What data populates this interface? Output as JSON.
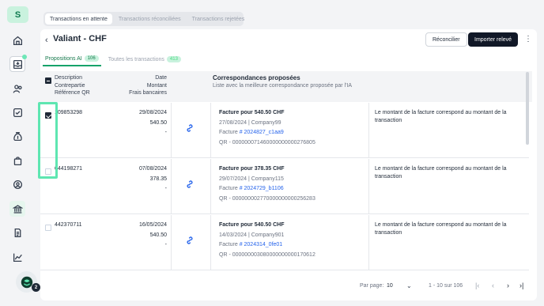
{
  "app": {
    "logo": "S"
  },
  "top_tabs": [
    "Transactions en attente",
    "Transactions réconciliées",
    "Transactions rejetées"
  ],
  "header": {
    "title": "Valiant - CHF",
    "reconcile_label": "Réconcilier",
    "import_label": "Importer relevé"
  },
  "sub_tabs": [
    {
      "label": "Propositions AI",
      "count": "106"
    },
    {
      "label": "Toutes les transactions",
      "count": "413"
    }
  ],
  "table_head": {
    "col1": [
      "Description",
      "Contrepartie",
      "Référence QR"
    ],
    "col2": [
      "Date",
      "Montant",
      "Frais bancaires"
    ],
    "col3_title": "Correspondances proposées",
    "col3_sub": "Liste avec la meilleure correspondance proposée par l'IA"
  },
  "rows": [
    {
      "checked": true,
      "ref": "109853298",
      "date": "29/08/2024",
      "amount": "540.50",
      "fee": "-",
      "match_title": "Facture pour 540.50 CHF",
      "match_meta": "27/08/2024 | Company99",
      "invoice_prefix": "Facture ",
      "invoice_ref": "# 2024827_c1aa9",
      "qr": "QR - 000000071460000000000276805",
      "reason": "Le montant de la facture correspond au montant de la transaction"
    },
    {
      "checked": false,
      "ref": "644198271",
      "date": "07/08/2024",
      "amount": "378.35",
      "fee": "-",
      "match_title": "Facture pour 378.35 CHF",
      "match_meta": "29/07/2024 | Company115",
      "invoice_prefix": "Facture ",
      "invoice_ref": "# 2024729_b1106",
      "qr": "QR - 000000002770000000000256283",
      "reason": "Le montant de la facture correspond au montant de la transaction"
    },
    {
      "checked": false,
      "ref": "442370711",
      "date": "16/05/2024",
      "amount": "540.50",
      "fee": "-",
      "match_title": "Facture pour 540.50 CHF",
      "match_meta": "14/03/2024 | Company901",
      "invoice_prefix": "Facture ",
      "invoice_ref": "# 2024314_0fe01",
      "qr": "QR - 000000003080000000000170612",
      "reason": "Le montant de la facture correspond au montant de la transaction"
    }
  ],
  "footer": {
    "per_page_label": "Par page:",
    "per_page_value": "10",
    "range": "1 - 10 sur 106"
  },
  "avatar_badge": "2",
  "colors": {
    "accent": "#16a36a",
    "link": "#2563eb",
    "dark_button": "#111827"
  }
}
